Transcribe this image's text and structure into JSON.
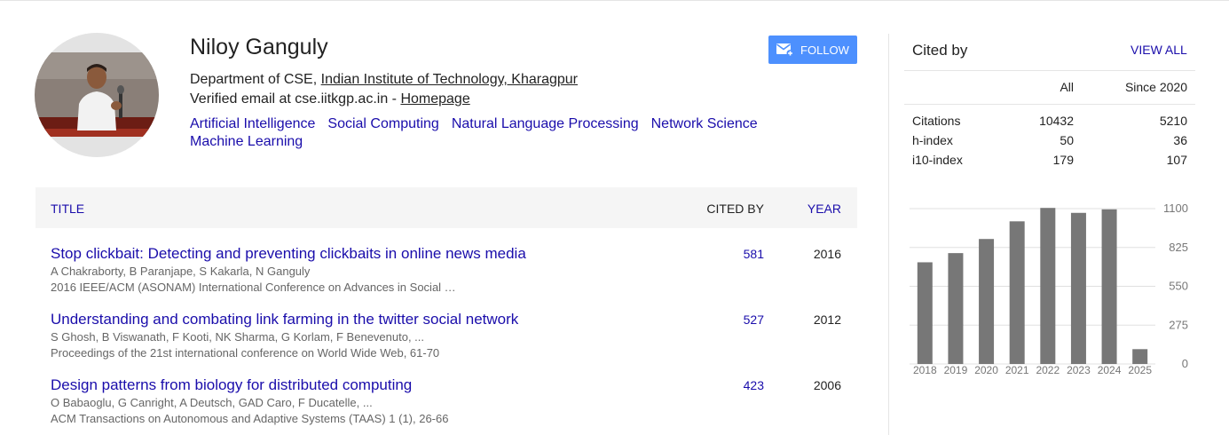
{
  "profile": {
    "name": "Niloy Ganguly",
    "affiliation_prefix": "Department of CSE, ",
    "affiliation_link": "Indian Institute of Technology, Kharagpur",
    "email_text": "Verified email at cse.iitkgp.ac.in - ",
    "homepage_label": "Homepage",
    "interests": [
      "Artificial Intelligence",
      "Social Computing",
      "Natural Language Processing",
      "Network Science",
      "Machine Learning"
    ],
    "follow_label": "FOLLOW"
  },
  "table": {
    "headers": {
      "title": "TITLE",
      "cited_by": "CITED BY",
      "year": "YEAR"
    },
    "rows": [
      {
        "title": "Stop clickbait: Detecting and preventing clickbaits in online news media",
        "authors": "A Chakraborty, B Paranjape, S Kakarla, N Ganguly",
        "venue": "2016 IEEE/ACM (ASONAM) International Conference on Advances in Social …",
        "cited_by": "581",
        "year": "2016"
      },
      {
        "title": "Understanding and combating link farming in the twitter social network",
        "authors": "S Ghosh, B Viswanath, F Kooti, NK Sharma, G Korlam, F Benevenuto, ...",
        "venue": "Proceedings of the 21st international conference on World Wide Web, 61-70",
        "cited_by": "527",
        "year": "2012"
      },
      {
        "title": "Design patterns from biology for distributed computing",
        "authors": "O Babaoglu, G Canright, A Deutsch, GAD Caro, F Ducatelle, ...",
        "venue": "ACM Transactions on Autonomous and Adaptive Systems (TAAS) 1 (1), 26-66",
        "cited_by": "423",
        "year": "2006"
      }
    ]
  },
  "cited_by": {
    "title": "Cited by",
    "view_all": "VIEW ALL",
    "col_all": "All",
    "col_since": "Since 2020",
    "stats": [
      {
        "label": "Citations",
        "all": "10432",
        "since": "5210"
      },
      {
        "label": "h-index",
        "all": "50",
        "since": "36"
      },
      {
        "label": "i10-index",
        "all": "179",
        "since": "107"
      }
    ]
  },
  "chart_data": {
    "type": "bar",
    "categories": [
      "2018",
      "2019",
      "2020",
      "2021",
      "2022",
      "2023",
      "2024",
      "2025"
    ],
    "values": [
      720,
      785,
      885,
      1010,
      1105,
      1070,
      1095,
      105
    ],
    "ylim": [
      0,
      1100
    ],
    "yticks": [
      "1100",
      "825",
      "550",
      "275",
      "0"
    ],
    "grid": true,
    "bar_color": "#777777"
  },
  "colors": {
    "link": "#1a0dab",
    "follow": "#4d90fe",
    "header_bg": "#f5f5f5"
  }
}
